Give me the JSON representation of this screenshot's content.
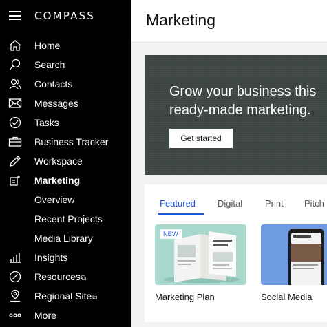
{
  "app": {
    "logo": "COMPASS"
  },
  "sidebar": {
    "items": [
      {
        "label": "Home",
        "icon": "home-icon"
      },
      {
        "label": "Search",
        "icon": "search-icon"
      },
      {
        "label": "Contacts",
        "icon": "contacts-icon"
      },
      {
        "label": "Messages",
        "icon": "envelope-icon"
      },
      {
        "label": "Tasks",
        "icon": "check-circle-icon"
      },
      {
        "label": "Business Tracker",
        "icon": "briefcase-icon"
      },
      {
        "label": "Workspace",
        "icon": "pencil-icon"
      },
      {
        "label": "Marketing",
        "icon": "marketing-icon",
        "active": true
      },
      {
        "label": "Overview"
      },
      {
        "label": "Recent Projects"
      },
      {
        "label": "Media Library"
      },
      {
        "label": "Insights",
        "icon": "bar-chart-icon"
      },
      {
        "label": "Resources",
        "icon": "compass-icon",
        "external": true
      },
      {
        "label": "Regional Site",
        "icon": "map-pin-icon",
        "external": true
      },
      {
        "label": "More",
        "icon": "more-dots-icon"
      }
    ],
    "external_glyph": "⧉"
  },
  "main": {
    "title": "Marketing",
    "hero": {
      "headline_line1": "Grow your business this",
      "headline_line2": "ready-made marketing.",
      "cta_label": "Get started"
    },
    "tabs": [
      {
        "label": "Featured",
        "active": true
      },
      {
        "label": "Digital"
      },
      {
        "label": "Print"
      },
      {
        "label": "Pitch"
      }
    ],
    "tiles": [
      {
        "label": "Marketing Plan",
        "badge": "NEW"
      },
      {
        "label": "Social Media"
      }
    ]
  },
  "colors": {
    "sidebar_bg": "#000000",
    "hero_bg": "#3d4540",
    "accent": "#1a56db",
    "tile_green": "#a8d8cc",
    "tile_blue": "#6f9be3"
  }
}
